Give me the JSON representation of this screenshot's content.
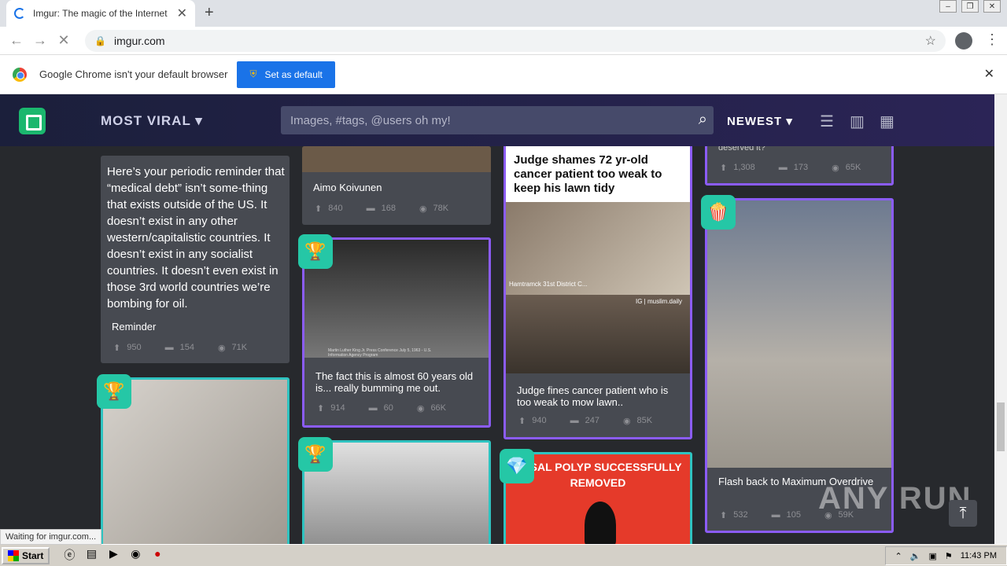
{
  "browser": {
    "tab_title": "Imgur: The magic of the Internet",
    "url": "imgur.com",
    "info": "Google Chrome isn't your default browser",
    "set_default": "Set as default"
  },
  "header": {
    "section": "MOST VIRAL ▾",
    "search_placeholder": "Images, #tags, @users oh my!",
    "sort": "NEWEST ▾"
  },
  "cards": [
    {
      "text": "Here’s your periodic reminder that “medical debt” isn’t some-thing that exists outside of the US. It doesn’t exist in any other western/capitalistic countries. It doesn’t exist in any socialist countries. It doesn’t even exist in those 3rd world countries we’re bombing for oil.",
      "title": "Reminder",
      "up": "950",
      "comments": "154",
      "views": "71K"
    },
    {
      "title": "Aimo Koivunen",
      "up": "840",
      "comments": "168",
      "views": "78K"
    },
    {
      "title": "The fact this is almost 60 years old is... really bumming me out.",
      "up": "914",
      "comments": "60",
      "views": "66K",
      "caption": "Martin Luther King Jr. Press Conference July 5, 1963 - U.S. Information Agency Program"
    },
    {
      "headline": "Judge shames 72 yr-old cancer patient too weak to keep his lawn tidy",
      "title": "Judge fines cancer patient who is too weak to mow lawn..",
      "up": "940",
      "comments": "247",
      "views": "85K",
      "tag": "IG | muslim.daily",
      "court": "Hamtramck 31st District C..."
    },
    {
      "partial": "deserved it?",
      "up": "1,308",
      "comments": "173",
      "views": "65K"
    },
    {
      "title": "Flash back to Maximum Overdrive",
      "up": "532",
      "comments": "105",
      "views": "59K"
    },
    {
      "meme": "NASAL POLYP SUCCESSFULLY REMOVED"
    }
  ],
  "status": "Waiting for imgur.com...",
  "taskbar": {
    "start": "Start",
    "time": "11:43 PM"
  },
  "watermark": "ANY RUN"
}
